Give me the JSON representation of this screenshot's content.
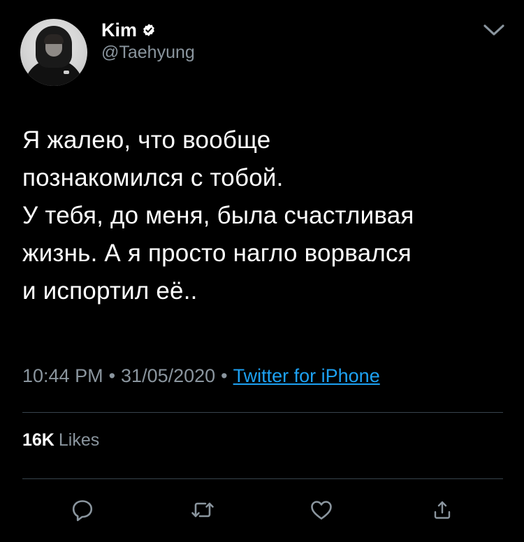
{
  "user": {
    "display_name": "Kim",
    "handle": "@Taehyung",
    "verified": true
  },
  "tweet": {
    "text": "Я жалею, что вообще\nпознакомился с тобой.\nУ тебя, до меня, была счастливая\nжизнь. А я просто нагло ворвался\nи испортил её..",
    "time": "10:44 PM",
    "date": "31/05/2020",
    "separator": "•",
    "source": "Twitter for iPhone"
  },
  "stats": {
    "likes_count": "16K",
    "likes_label": "Likes"
  },
  "icons": {
    "verified": "verified-badge-icon",
    "menu": "chevron-down-icon",
    "reply": "reply-icon",
    "retweet": "retweet-icon",
    "like": "heart-icon",
    "share": "share-icon"
  },
  "colors": {
    "background": "#000000",
    "text": "#ffffff",
    "secondary_text": "#8a959e",
    "link": "#1da1f2",
    "divider": "#38444d"
  }
}
